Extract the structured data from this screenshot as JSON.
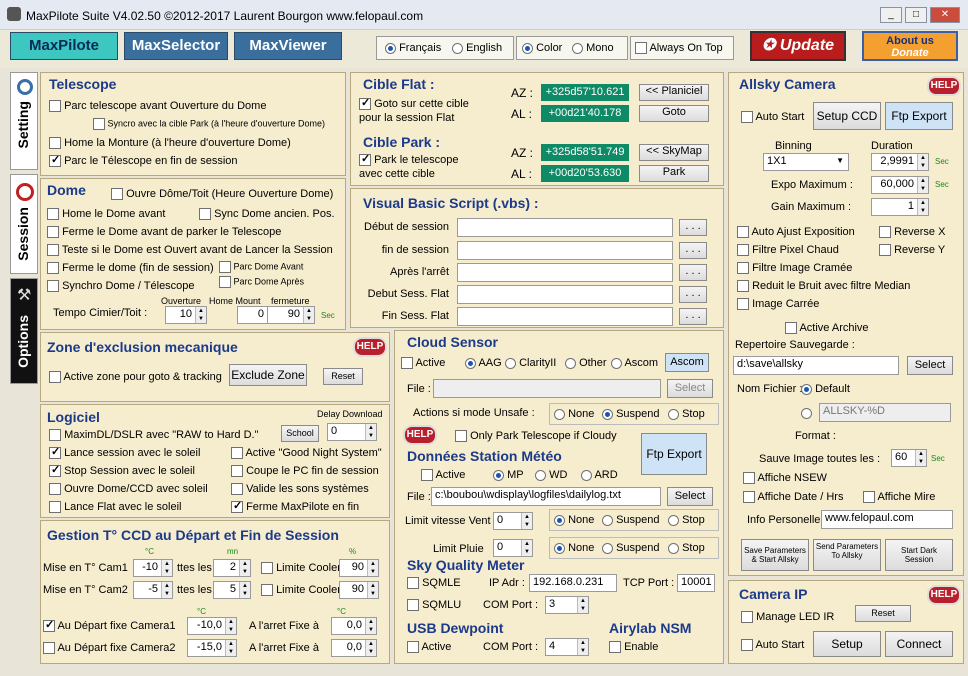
{
  "title": "MaxPilote Suite  V4.02.50  ©2012-2017  Laurent Bourgon  www.felopaul.com",
  "tabs": [
    "MaxPilote",
    "MaxSelector",
    "MaxViewer"
  ],
  "lang": {
    "fr": "Français",
    "en": "English"
  },
  "mode": {
    "color": "Color",
    "mono": "Mono"
  },
  "always_on_top": "Always On Top",
  "update": "Update",
  "about": "About us",
  "donate": "Donate",
  "side": {
    "setting": "Setting",
    "session": "Session",
    "options": "Options"
  },
  "telescope": {
    "title": "Telescope",
    "items": [
      "Parc telescope avant Ouverture du Dome",
      "Syncro avec la cible Park (à l'heure d'ouverture Dome)",
      "Home la Monture  (à l'heure d'ouverture Dome)",
      "Parc le Télescope en fin de session"
    ]
  },
  "dome": {
    "title": "Dome",
    "open": "Ouvre Dôme/Toit (Heure Ouverture Dome)",
    "items": [
      "Home le Dome avant",
      "Sync Dome ancien. Pos.",
      "Ferme le Dome avant de parker le Telescope",
      "Teste si le Dome est Ouvert avant de Lancer la Session",
      "Ferme le dome (fin de session)",
      "Parc Dome Avant",
      "Synchro  Dome / Télescope",
      "Parc Dome Après"
    ],
    "tempo": "Tempo Cimier/Toit :",
    "cols": [
      "Ouverture",
      "Home Mount",
      "fermeture"
    ],
    "vals": [
      "10",
      "0",
      "90"
    ],
    "sec": "Sec"
  },
  "cible_flat": {
    "title": "Cible Flat :",
    "goto": "Goto sur cette cible pour la session Flat",
    "az_l": "AZ :",
    "al_l": "AL :",
    "az": "+325d57'10.621",
    "al": "+00d21'40.178",
    "b1": "<< Planiciel",
    "b2": "Goto"
  },
  "cible_park": {
    "title": "Cible Park :",
    "park": "Park le telescope avec cette cible",
    "az": "+325d58'51.749",
    "al": "+00d20'53.630",
    "b1": "<< SkyMap",
    "b2": "Park"
  },
  "vbs": {
    "title": "Visual Basic Script  (.vbs) :",
    "rows": [
      "Début de session",
      "fin de session",
      "Après l'arrêt",
      "Debut Sess. Flat",
      "Fin Sess. Flat"
    ],
    "dots": ". . ."
  },
  "zone": {
    "title": "Zone d'exclusion mecanique",
    "active": "Active zone pour goto & tracking",
    "btn": "Exclude Zone",
    "reset": "Reset",
    "help": "HELP"
  },
  "logiciel": {
    "title": "Logiciel",
    "delay": "Delay Download",
    "delay_val": "0",
    "school": "School",
    "items": [
      "MaximDL/DSLR avec \"RAW to Hard D.\"",
      "Lance session avec le soleil",
      "Active \"Good Night System\"",
      "Stop Session avec le soleil",
      "Coupe le PC fin de session",
      "Ouvre Dome/CCD avec soleil",
      "Valide les sons systèmes",
      "Lance Flat avec le soleil",
      "Ferme MaxPilote en fin"
    ]
  },
  "ccd": {
    "title": "Gestion T° CCD au Départ et Fin  de Session",
    "c": "°C",
    "mn": "mn",
    "pct": "%",
    "cam1": "Mise en T°  Cam1",
    "cam2": "Mise en T°  Cam2",
    "t1": "-10",
    "t2": "-5",
    "ttes": "ttes les",
    "m1": "2",
    "m2": "5",
    "lim": "Limite Cooler",
    "p1": "90",
    "p2": "90",
    "dep1": "Au Départ fixe Camera1",
    "dep2": "Au Départ fixe Camera2",
    "d1": "-10,0",
    "d2": "-15,0",
    "arr": "A l'arret Fixe à",
    "a1": "0,0",
    "a2": "0,0"
  },
  "cloud": {
    "title": "Cloud Sensor",
    "active": "Active",
    "aag": "AAG",
    "clarity": "ClarityII",
    "other": "Other",
    "ascom": "Ascom",
    "ascom_btn": "Ascom",
    "file": "File :",
    "select": "Select",
    "unsafe": "Actions si mode Unsafe :",
    "none": "None",
    "suspend": "Suspend",
    "stop": "Stop",
    "only": "Only Park Telescope  if Cloudy"
  },
  "meteo": {
    "title": "Données Station Météo",
    "active": "Active",
    "mp": "MP",
    "wd": "WD",
    "ard": "ARD",
    "ftp": "Ftp Export",
    "file": "File :",
    "path": "c:\\boubou\\wdisplay\\logfiles\\dailylog.txt",
    "select": "Select",
    "vent": "Limit vitesse Vent",
    "vent_val": "0",
    "pluie": "Limit Pluie",
    "pluie_val": "0",
    "none": "None",
    "suspend": "Suspend",
    "stop": "Stop"
  },
  "sqm": {
    "title": "Sky Quality Meter",
    "sqmle": "SQMLE",
    "sqmlu": "SQMLU",
    "ip_l": "IP Adr :",
    "ip": "192.168.0.231",
    "tcp_l": "TCP Port :",
    "tcp": "10001",
    "com_l": "COM Port :",
    "com": "3"
  },
  "usb": {
    "title": "USB Dewpoint",
    "active": "Active",
    "com_l": "COM Port :",
    "com": "4"
  },
  "airylab": {
    "title": "Airylab NSM",
    "enable": "Enable"
  },
  "allsky": {
    "title": "Allsky Camera",
    "auto": "Auto Start",
    "setup": "Setup CCD",
    "ftp": "Ftp Export",
    "binning": "Binning",
    "bin": "1X1",
    "duration": "Duration",
    "dur": "2,9991",
    "sec": "Sec",
    "expo_l": "Expo Maximum :",
    "expo": "60,000",
    "gain_l": "Gain Maximum :",
    "gain": "1",
    "auto_ajust": "Auto Ajust  Exposition",
    "revx": "Reverse X",
    "filtre_pix": "Filtre Pixel Chaud",
    "revy": "Reverse Y",
    "filtre_img": "Filtre Image Cramée",
    "reduit": "Reduit le Bruit avec filtre Median",
    "carree": "Image Carrée",
    "archive": "Active Archive",
    "rep": "Repertoire Sauvegarde :",
    "path": "d:\\save\\allsky",
    "select": "Select",
    "nom": "Nom Fichier :",
    "default": "Default",
    "nom_val": "ALLSKY-%D",
    "format": "Format :",
    "sauve": "Sauve Image toutes les :",
    "sauve_val": "60",
    "nsew": "Affiche NSEW",
    "date": "Affiche Date / Hrs",
    "mire": "Affiche Mire",
    "info_l": "Info Personelle",
    "info": "www.felopaul.com",
    "b1": "Save Parameters & Start Allsky",
    "b2": "Send Parameters To Allsky",
    "b3": "Start Dark Session"
  },
  "camip": {
    "title": "Camera IP",
    "led": "Manage LED IR",
    "reset": "Reset",
    "auto": "Auto Start",
    "setup": "Setup",
    "connect": "Connect"
  }
}
